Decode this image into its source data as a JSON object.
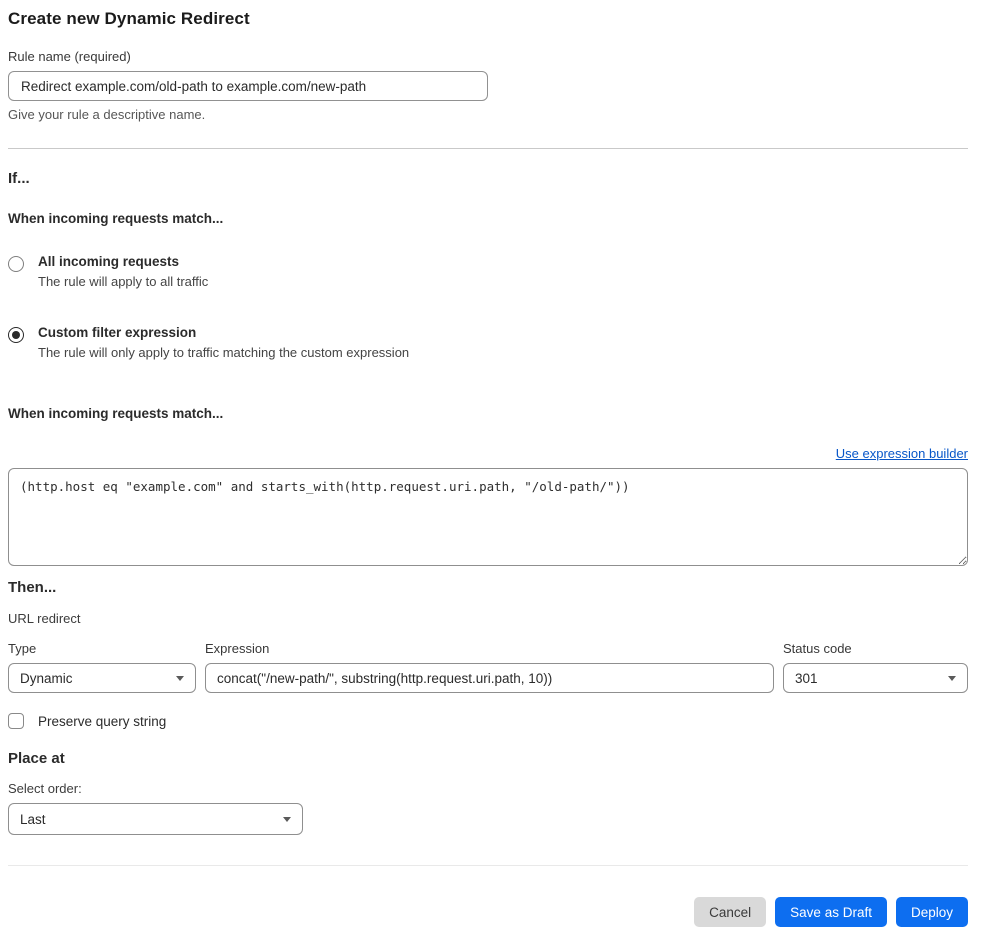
{
  "page": {
    "title": "Create new Dynamic Redirect"
  },
  "rule_name": {
    "label": "Rule name (required)",
    "value": "Redirect example.com/old-path to example.com/new-path",
    "help": "Give your rule a descriptive name."
  },
  "if_section": {
    "heading": "If...",
    "match_heading": "When incoming requests match...",
    "options": [
      {
        "label": "All incoming requests",
        "description": "The rule will apply to all traffic",
        "selected": false
      },
      {
        "label": "Custom filter expression",
        "description": "The rule will only apply to traffic matching the custom expression",
        "selected": true
      }
    ],
    "expression_heading": "When incoming requests match...",
    "builder_link_label": "Use expression builder",
    "expression_value": "(http.host eq \"example.com\" and starts_with(http.request.uri.path, \"/old-path/\"))"
  },
  "then_section": {
    "heading": "Then...",
    "action_label": "URL redirect",
    "type": {
      "label": "Type",
      "value": "Dynamic"
    },
    "expression": {
      "label": "Expression",
      "value": "concat(\"/new-path/\", substring(http.request.uri.path, 10))"
    },
    "status_code": {
      "label": "Status code",
      "value": "301"
    },
    "preserve_query": {
      "label": "Preserve query string",
      "checked": false
    }
  },
  "place_at": {
    "heading": "Place at",
    "label": "Select order:",
    "value": "Last"
  },
  "footer": {
    "cancel_label": "Cancel",
    "save_draft_label": "Save as Draft",
    "deploy_label": "Deploy"
  },
  "colors": {
    "primary_button": "#0d6ef0",
    "link_blue": "#0756c8",
    "cancel_button": "#d9d9d9"
  }
}
